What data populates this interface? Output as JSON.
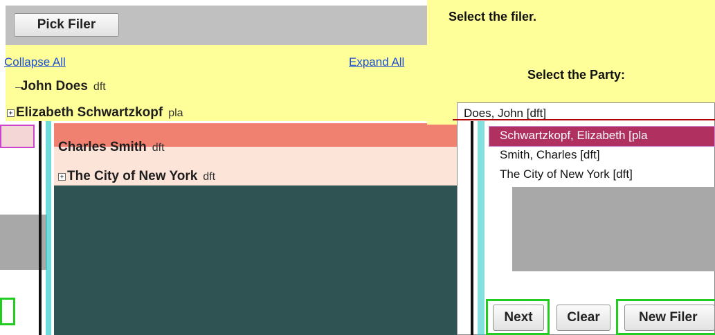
{
  "left_panel": {
    "pick_filer_label": "Pick Filer",
    "collapse_all": "Collapse All",
    "expand_all": "Expand All",
    "tree": [
      {
        "name": "John Does",
        "role": "dft",
        "expandable": false
      },
      {
        "name": "Elizabeth Schwartzkopf",
        "role": "pla",
        "expandable": true
      },
      {
        "name": "Charles Smith",
        "role": "dft",
        "expandable": false
      },
      {
        "name": "The City of New York",
        "role": "dft",
        "expandable": true
      }
    ]
  },
  "right_panel": {
    "instruction": "Select the filer.",
    "party_label": "Select the Party:",
    "party_options": [
      "Does, John [dft]",
      "Schwartzkopf, Elizabeth [pla",
      "Smith, Charles [dft]",
      "The City of New York [dft]"
    ],
    "selected_index": 1,
    "buttons": {
      "next": "Next",
      "clear": "Clear",
      "new_filer": "New Filer"
    }
  },
  "colors": {
    "left_header_bg": "#c0c0c0",
    "left_tree_bg": "#ffff99",
    "right_bg": "#ffff99",
    "selection_bg": "#b03060",
    "glitch_teal": "#2f5252",
    "glitch_salmon": "#f08070",
    "highlight_green": "#22cc22"
  }
}
